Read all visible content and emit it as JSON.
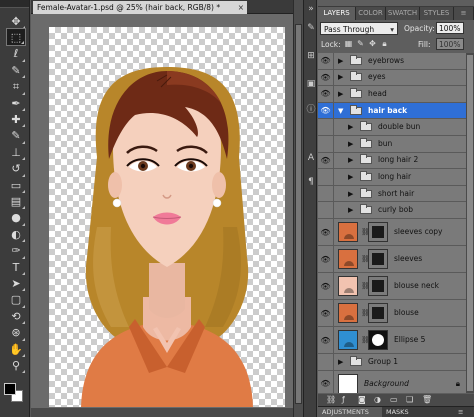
{
  "document": {
    "tab_title": "Female-Avatar-1.psd @ 25% (hair back, RGB/8) *",
    "close_glyph": "×"
  },
  "toolbar": {
    "tools": [
      {
        "icon": "move-icon",
        "glyph": "✥"
      },
      {
        "icon": "marquee-icon",
        "glyph": "⬚"
      },
      {
        "icon": "lasso-icon",
        "glyph": "ℓ"
      },
      {
        "icon": "quick-select-icon",
        "glyph": "✎"
      },
      {
        "icon": "crop-icon",
        "glyph": "⌗"
      },
      {
        "icon": "eyedropper-icon",
        "glyph": "✒"
      },
      {
        "icon": "healing-icon",
        "glyph": "✚"
      },
      {
        "icon": "brush-icon",
        "glyph": "✎"
      },
      {
        "icon": "stamp-icon",
        "glyph": "⊥"
      },
      {
        "icon": "history-brush-icon",
        "glyph": "↺"
      },
      {
        "icon": "eraser-icon",
        "glyph": "▭"
      },
      {
        "icon": "gradient-icon",
        "glyph": "▤"
      },
      {
        "icon": "blur-icon",
        "glyph": "●"
      },
      {
        "icon": "dodge-icon",
        "glyph": "◐"
      },
      {
        "icon": "pen-icon",
        "glyph": "✑"
      },
      {
        "icon": "type-icon",
        "glyph": "T"
      },
      {
        "icon": "path-select-icon",
        "glyph": "➤"
      },
      {
        "icon": "shape-icon",
        "glyph": "▢"
      },
      {
        "icon": "3d-rotate-icon",
        "glyph": "⟲"
      },
      {
        "icon": "3d-orbit-icon",
        "glyph": "⊛"
      },
      {
        "icon": "hand-icon",
        "glyph": "✋"
      },
      {
        "icon": "zoom-icon",
        "glyph": "⚲"
      }
    ],
    "selected_index": 1,
    "foreground_color": "#000000",
    "background_color": "#ffffff"
  },
  "panel": {
    "tabs": [
      "LAYERS",
      "COLOR",
      "SWATCH",
      "STYLES"
    ],
    "active_tab": "LAYERS",
    "blend_mode": "Pass Through",
    "opacity_label": "Opacity:",
    "opacity_value": "100%",
    "lock_label": "Lock:",
    "fill_label": "Fill:",
    "fill_value": "100%",
    "layers": [
      {
        "name": "eyebrows",
        "type": "group",
        "indent": 0,
        "visible": true,
        "selected": false
      },
      {
        "name": "eyes",
        "type": "group",
        "indent": 0,
        "visible": true,
        "selected": false
      },
      {
        "name": "head",
        "type": "group",
        "indent": 0,
        "visible": true,
        "selected": false
      },
      {
        "name": "hair back",
        "type": "group",
        "indent": 0,
        "visible": true,
        "selected": true,
        "expanded": true
      },
      {
        "name": "double bun",
        "type": "group",
        "indent": 1,
        "visible": false,
        "selected": false
      },
      {
        "name": "bun",
        "type": "group",
        "indent": 1,
        "visible": false,
        "selected": false
      },
      {
        "name": "long hair 2",
        "type": "group",
        "indent": 1,
        "visible": true,
        "selected": false
      },
      {
        "name": "long hair",
        "type": "group",
        "indent": 1,
        "visible": false,
        "selected": false
      },
      {
        "name": "short hair",
        "type": "group",
        "indent": 1,
        "visible": false,
        "selected": false
      },
      {
        "name": "curly bob",
        "type": "group",
        "indent": 1,
        "visible": false,
        "selected": false
      },
      {
        "name": "sleeves copy",
        "type": "shape",
        "color": "#d9703f",
        "visible": true,
        "selected": false
      },
      {
        "name": "sleeves",
        "type": "shape",
        "color": "#d9703f",
        "visible": true,
        "selected": false
      },
      {
        "name": "blouse neck",
        "type": "shape",
        "color": "#f2c3b0",
        "visible": true,
        "selected": false
      },
      {
        "name": "blouse",
        "type": "shape",
        "color": "#d9703f",
        "visible": true,
        "selected": false
      },
      {
        "name": "Ellipse 5",
        "type": "ellipse",
        "color": "#2f8fd2",
        "visible": true,
        "selected": false
      },
      {
        "name": "Group 1",
        "type": "group",
        "indent": 0,
        "visible": false,
        "selected": false
      },
      {
        "name": "Background",
        "type": "background",
        "color": "#ffffff",
        "visible": true,
        "selected": false,
        "locked": true
      }
    ],
    "bottom_tabs": [
      "ADJUSTMENTS",
      "MASKS"
    ]
  },
  "iconstrip": {
    "icons": [
      {
        "name": "dock-toggle-icon",
        "glyph": "»"
      },
      {
        "name": "notes-icon",
        "glyph": "✎"
      },
      {
        "name": "history-icon",
        "glyph": "⊞"
      },
      {
        "name": "navigator-icon",
        "glyph": "▣"
      },
      {
        "name": "info-icon",
        "glyph": "ⓘ"
      },
      {
        "name": "character-icon",
        "glyph": "A"
      },
      {
        "name": "paragraph-icon",
        "glyph": "¶"
      }
    ]
  }
}
